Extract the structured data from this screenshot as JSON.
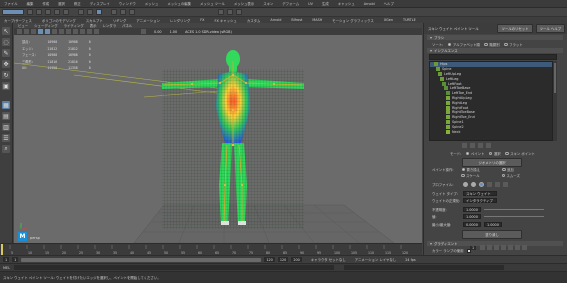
{
  "menubar": {
    "items": [
      "ファイル",
      "編集",
      "作成",
      "選択",
      "修正",
      "ディスプレイ",
      "ウィンドウ",
      "メッシュ",
      "メッシュの編集",
      "メッシュ ツール",
      "メッシュ表示",
      "スキン",
      "デフォーム",
      "UV",
      "生成",
      "キャッシュ",
      "Arnold",
      "ヘルプ"
    ]
  },
  "shelf": {
    "tabs": [
      "カーブ/サーフェス",
      "ポリゴンのモデリング",
      "スカルプト",
      "リギング",
      "アニメーション",
      "レンダリング",
      "FX",
      "FX キャッシュ",
      "カスタム",
      "Arnold",
      "Bifrost",
      "MASH",
      "モーション グラフィックス",
      "XGen",
      "TURTLE"
    ]
  },
  "viewport": {
    "menu": [
      "ビュー",
      "シェーディング",
      "ライティング",
      "表示",
      "レンダラ",
      "パネル"
    ],
    "hud": {
      "headers": [
        "",
        "",
        "",
        "",
        ""
      ],
      "rows": [
        [
          "頂点:",
          "10908",
          "10908",
          "0"
        ],
        [
          "エッジ:",
          "21812",
          "21812",
          "0"
        ],
        [
          "フェース:",
          "10908",
          "10908",
          "0"
        ],
        [
          "三角形:",
          "21816",
          "21816",
          "0"
        ],
        [
          "UV:",
          "11358",
          "11358",
          "0"
        ]
      ]
    },
    "camera_label": "persp",
    "gamma_value": "0.00",
    "scale_value": "1.00",
    "color_space": "ACES 1.0 SDR-video (sRGB)"
  },
  "panel": {
    "title": "スキン ウェイト ペイント ツール",
    "reset_button": "ツールのリセット",
    "help_button": "ツール ヘルプ",
    "brush_section": "ブラシ",
    "influence_section": "インフルエンス",
    "sort_label": "ソート:",
    "sort_options": [
      "アルファベット順",
      "階層別",
      "フラット"
    ],
    "filter_placeholder": "",
    "joints": [
      {
        "name": "Hips",
        "color": "#6a9a3a"
      },
      {
        "name": "Spine",
        "color": "#6a9a3a"
      },
      {
        "name": "LeftUpLeg",
        "color": "#6a9a3a"
      },
      {
        "name": "LeftLeg",
        "color": "#6a9a3a"
      },
      {
        "name": "LeftFoot",
        "color": "#5a8f3a"
      },
      {
        "name": "LeftToeBase",
        "color": "#5a8f3a"
      },
      {
        "name": "LeftToe_End",
        "color": "#5a8f3a"
      },
      {
        "name": "RightUpLeg",
        "color": "#7aa83a"
      },
      {
        "name": "RightLeg",
        "color": "#7aa83a"
      },
      {
        "name": "RightFoot",
        "color": "#7aa83a"
      },
      {
        "name": "RightToeBase",
        "color": "#7aa83a"
      },
      {
        "name": "RightToe_End",
        "color": "#7aa83a"
      },
      {
        "name": "Spine1",
        "color": "#7aa83a"
      },
      {
        "name": "Spine2",
        "color": "#7aa83a"
      },
      {
        "name": "Neck",
        "color": "#8ab03a"
      }
    ],
    "mode_label": "モード:",
    "mode_options": [
      "ペイント",
      "選択",
      "スキン ポイント"
    ],
    "select_geometry_button": "ジオメトリの選択",
    "paint_op_label": "ペイント操作:",
    "paint_ops": [
      "置き換え",
      "追加",
      "スケール",
      "スムーズ"
    ],
    "profile_label": "プロファイル:",
    "weight_type_label": "ウェイト タイプ:",
    "weight_type_value": "スキン ウェイト",
    "normalize_label": "ウェイトの正規化:",
    "normalize_value": "インタラクティブ",
    "opacity_label": "不透明度:",
    "opacity_value": "1.0000",
    "value_label": "値:",
    "value_value": "1.0000",
    "minmax_label": "最小/最大値:",
    "min_value": "0.0000",
    "max_value": "1.0000",
    "flood_button": "塗り潰し",
    "gradient_section": "グラディエント",
    "color_ramp_label": "カラー ランプの使用"
  },
  "timeline": {
    "ticks": [
      "5",
      "10",
      "15",
      "20",
      "25",
      "30",
      "35",
      "40",
      "45",
      "50",
      "55",
      "60",
      "65",
      "70",
      "75",
      "80",
      "85",
      "90",
      "95",
      "100",
      "105",
      "110",
      "115",
      "120"
    ],
    "current_frame": "1"
  },
  "range": {
    "start": "1",
    "inner_start": "1",
    "inner_end": "120",
    "end": "120",
    "end2": "200",
    "character_set": "キャラクタ セットなし",
    "anim_layer": "アニメーション レイヤなし",
    "fps": "24 fps"
  },
  "cmdline": {
    "label": "MEL"
  },
  "helpline": {
    "text": "スキン ウェイト ペイント ツール: ウェイトを付けたいエッジを選択し、ペイントを開始してください。"
  }
}
